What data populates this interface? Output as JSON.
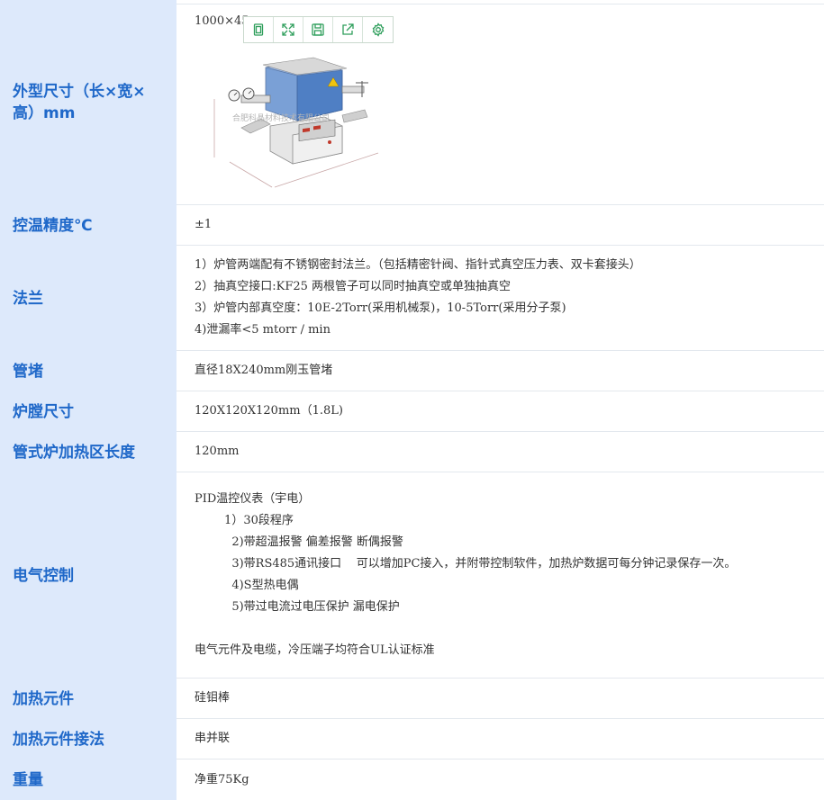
{
  "rows": [
    {
      "label": [
        "外型尺寸（长×宽×",
        "高）mm"
      ],
      "lines": [
        "1000×45"
      ]
    },
    {
      "label": [
        "控温精度℃"
      ],
      "lines": [
        "±1"
      ]
    },
    {
      "label": [
        "法兰"
      ],
      "lines": [
        "1）炉管两端配有不锈钢密封法兰。（包括精密针阀、指针式真空压力表、双卡套接头）",
        "2）抽真空接口:KF25 两根管子可以同时抽真空或单独抽真空",
        "3）炉管内部真空度：10E-2Torr(采用机械泵)，10-5Torr(采用分子泵)",
        "4)泄漏率<5 mtorr / min"
      ]
    },
    {
      "label": [
        "管堵"
      ],
      "lines": [
        "直径18X240mm刚玉管堵"
      ]
    },
    {
      "label": [
        "炉膛尺寸"
      ],
      "lines": [
        "120X120X120mm（1.8L)"
      ]
    },
    {
      "label": [
        "管式炉加热区长度"
      ],
      "lines": [
        "120mm"
      ]
    },
    {
      "label": [
        "电气控制"
      ],
      "lines": [
        "PID温控仪表（宇电）",
        "        1）30段程序",
        "          2)带超温报警 偏差报警 断偶报警",
        "          3)带RS485通讯接口    可以增加PC接入，并附带控制软件，加热炉数据可每分钟记录保存一次。",
        "          4)S型热电偶",
        "          5)带过电流过电压保护 漏电保护",
        "",
        "电气元件及电缆，冷压端子均符合UL认证标准"
      ]
    },
    {
      "label": [
        "加热元件"
      ],
      "lines": [
        "硅钼棒"
      ]
    },
    {
      "label": [
        "加热元件接法"
      ],
      "lines": [
        "串并联"
      ]
    },
    {
      "label": [
        "重量"
      ],
      "lines": [
        "净重75Kg"
      ]
    }
  ],
  "image": {
    "watermark": "合肥科晶材料技术有限公司"
  },
  "toolbar": [
    {
      "icon": "copy-icon"
    },
    {
      "icon": "expand-icon"
    },
    {
      "icon": "save-icon"
    },
    {
      "icon": "share-icon"
    },
    {
      "icon": "settings-icon"
    }
  ],
  "colors": {
    "label_bg": "#dde9fb",
    "label_text": "#1f68c9",
    "toolbar_icon": "#2e9e5b"
  }
}
